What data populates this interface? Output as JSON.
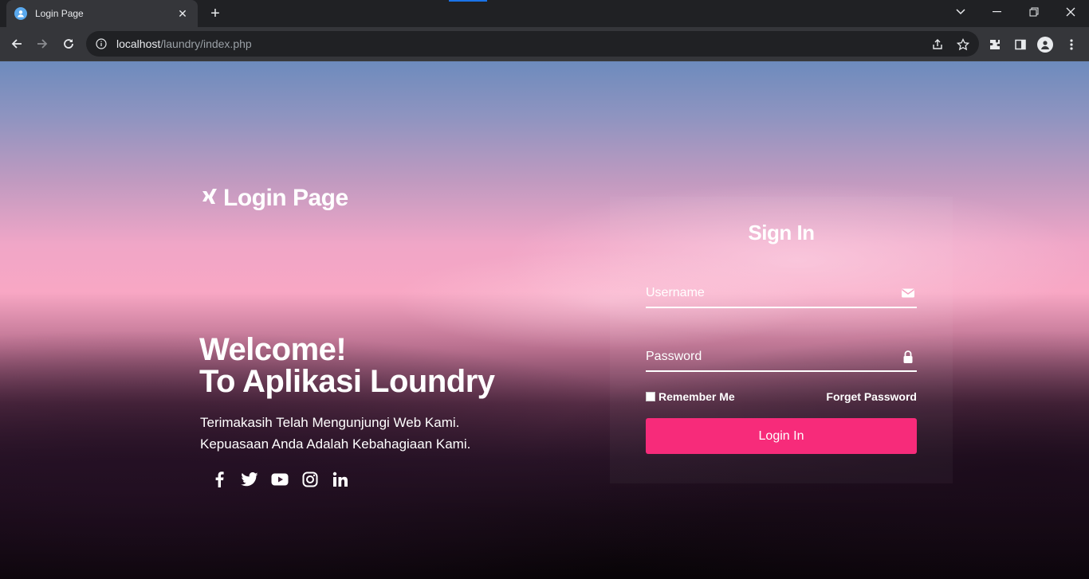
{
  "browser": {
    "tab_title": "Login Page",
    "tab_close": "✕",
    "new_tab": "+",
    "url_host": "localhost",
    "url_path": "/laundry/index.php"
  },
  "brand": {
    "title": "Login Page"
  },
  "welcome": {
    "line1": "Welcome!",
    "line2": "To Aplikasi Loundry",
    "tagline1": "Terimakasih Telah Mengunjungi Web Kami.",
    "tagline2": "Kepuasaan Anda Adalah Kebahagiaan Kami."
  },
  "socials": [
    "facebook-icon",
    "twitter-icon",
    "youtube-icon",
    "instagram-icon",
    "linkedin-icon"
  ],
  "signin": {
    "title": "Sign In",
    "username_placeholder": "Username",
    "password_placeholder": "Password",
    "remember_label": "Remember Me",
    "forget_label": "Forget Password",
    "login_label": "Login In"
  },
  "colors": {
    "accent": "#f72b7a",
    "chrome_dark": "#202124",
    "chrome_toolbar": "#35363a"
  }
}
